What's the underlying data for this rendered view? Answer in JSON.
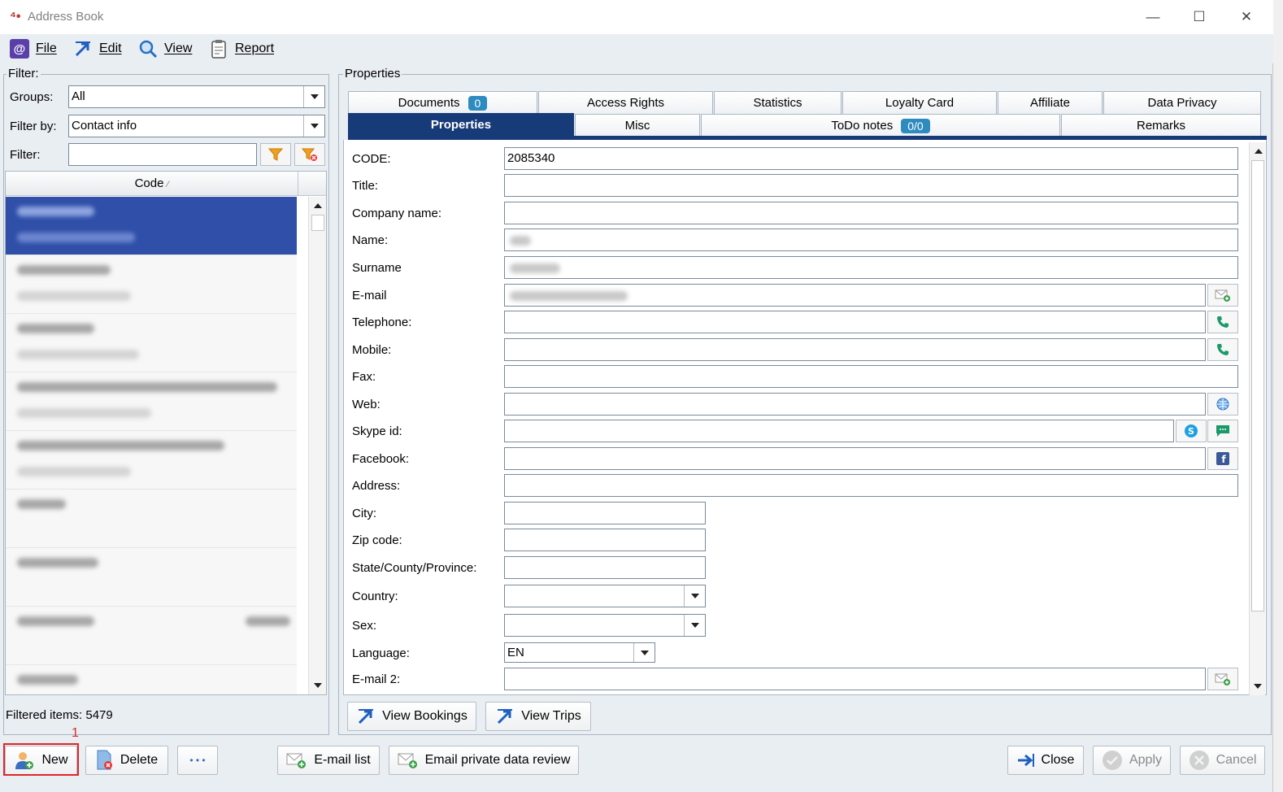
{
  "window": {
    "title": "Address Book"
  },
  "menu": {
    "file": "File",
    "edit": "Edit",
    "view": "View",
    "report": "Report"
  },
  "filter": {
    "legend": "Filter:",
    "groups_label": "Groups:",
    "groups_value": "All",
    "filter_by_label": "Filter by:",
    "filter_by_value": "Contact info",
    "filter_label": "Filter:",
    "filter_value": ""
  },
  "list": {
    "column_header": "Code",
    "sort_glyph": "⁄",
    "row_count": 9,
    "selected_index": 0
  },
  "status": {
    "filtered_label": "Filtered items:",
    "filtered_count": "5479"
  },
  "properties": {
    "legend": "Properties",
    "tabs_row1": [
      {
        "label": "Documents",
        "badge": "0"
      },
      {
        "label": "Access Rights"
      },
      {
        "label": "Statistics"
      },
      {
        "label": "Loyalty Card"
      },
      {
        "label": "Affiliate"
      },
      {
        "label": "Data Privacy"
      }
    ],
    "tabs_row2": [
      {
        "label": "Properties",
        "active": true
      },
      {
        "label": "Misc"
      },
      {
        "label": "ToDo notes",
        "badge": "0/0"
      },
      {
        "label": "Remarks"
      }
    ],
    "fields": {
      "code": {
        "label": "CODE:",
        "value": "2085340"
      },
      "title": {
        "label": "Title:",
        "value": ""
      },
      "company": {
        "label": "Company name:",
        "value": ""
      },
      "name": {
        "label": "Name:",
        "value": ""
      },
      "surname": {
        "label": "Surname",
        "value": ""
      },
      "email": {
        "label": "E-mail",
        "value": ""
      },
      "telephone": {
        "label": "Telephone:",
        "value": ""
      },
      "mobile": {
        "label": "Mobile:",
        "value": ""
      },
      "fax": {
        "label": "Fax:",
        "value": ""
      },
      "web": {
        "label": "Web:",
        "value": ""
      },
      "skype": {
        "label": "Skype id:",
        "value": ""
      },
      "facebook": {
        "label": "Facebook:",
        "value": ""
      },
      "address": {
        "label": "Address:",
        "value": ""
      },
      "city": {
        "label": "City:",
        "value": ""
      },
      "zip": {
        "label": "Zip code:",
        "value": ""
      },
      "state": {
        "label": "State/County/Province:",
        "value": ""
      },
      "country": {
        "label": "Country:",
        "value": ""
      },
      "sex": {
        "label": "Sex:",
        "value": ""
      },
      "language": {
        "label": "Language:",
        "value": "EN"
      },
      "email2": {
        "label": "E-mail 2:",
        "value": ""
      }
    },
    "view_bookings": "View Bookings",
    "view_trips": "View Trips"
  },
  "bottom": {
    "new": "New",
    "delete": "Delete",
    "more": "• • •",
    "email_list": "E-mail list",
    "email_review": "Email private data review",
    "close": "Close",
    "apply": "Apply",
    "cancel": "Cancel",
    "annotation": "1"
  },
  "colors": {
    "accent": "#173a78",
    "badge": "#2e8bbf",
    "highlight": "#e0262b",
    "selection": "#2f4fa8"
  }
}
